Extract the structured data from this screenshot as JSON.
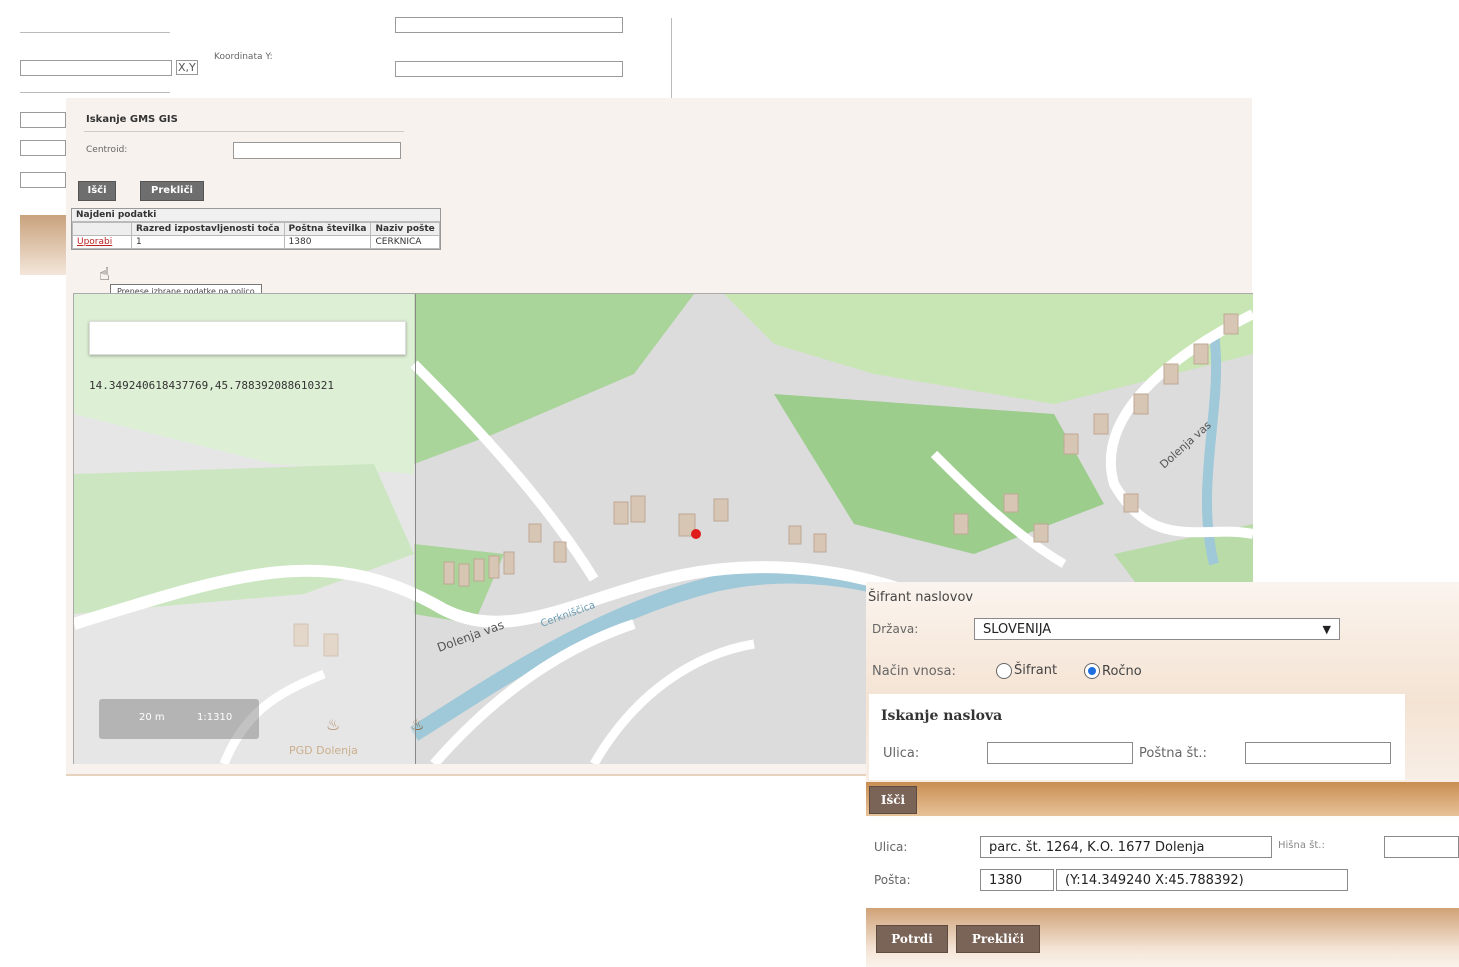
{
  "background_form": {
    "coord_label": "Koordinata Y:",
    "xy_button": "X,Y"
  },
  "gms": {
    "title": "Iskanje GMS GIS",
    "field_label": "Centroid:",
    "search_button": "Išči",
    "cancel_button": "Prekliči",
    "results_title": "Najdeni podatki",
    "columns": [
      "",
      "Razred izpostavljenosti toča",
      "Poštna številka",
      "Naziv pošte"
    ],
    "row": {
      "action": "Uporabi",
      "class": "1",
      "postal": "1380",
      "post_name": "CERKNICA"
    },
    "tooltip": "Prenese izbrane podatke na polico"
  },
  "map": {
    "coords_text": "14.349240618437769,45.788392088610321",
    "street_label_1": "Dolenja vas",
    "street_label_2": "Dolenja vas",
    "river_label": "Cerkniščica",
    "poi_label": "PGD Dolenja",
    "scale_label": "20 m",
    "scale_ratio": "1:1310"
  },
  "address": {
    "title": "Šifrant naslovov",
    "country_label": "Država:",
    "country_value": "SLOVENIJA",
    "mode_label": "Način vnosa:",
    "mode_options": [
      "Šifrant",
      "Ročno"
    ],
    "mode_selected": "Ročno",
    "search_title": "Iskanje naslova",
    "street_label": "Ulica:",
    "postal_label": "Poštna št.:",
    "search_button": "Išči",
    "result_street_label": "Ulica:",
    "result_street_value": "parc. št. 1264, K.O. 1677 Dolenja",
    "house_label": "Hišna št.:",
    "post_label": "Pošta:",
    "post_code": "1380",
    "post_coords": "(Y:14.349240 X:45.788392)",
    "confirm_button": "Potrdi",
    "cancel_button": "Prekliči"
  }
}
